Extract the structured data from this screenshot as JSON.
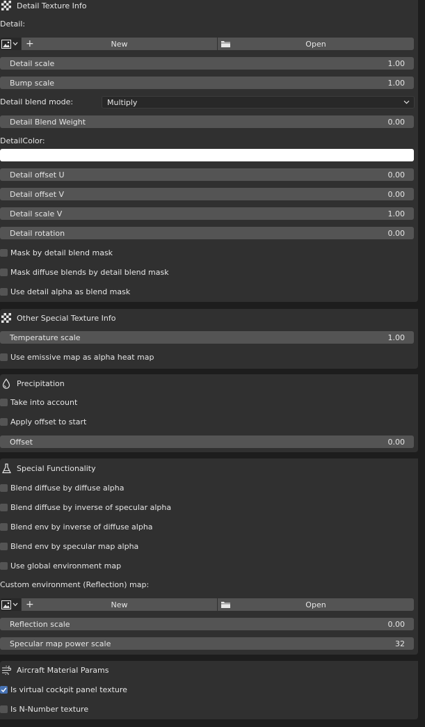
{
  "detail_panel": {
    "title": "Detail Texture Info",
    "detail_label": "Detail:",
    "new_label": "New",
    "open_label": "Open",
    "detail_scale": {
      "label": "Detail scale",
      "value": "1.00"
    },
    "bump_scale": {
      "label": "Bump scale",
      "value": "1.00"
    },
    "blend_mode": {
      "label": "Detail blend mode:",
      "value": "Multiply"
    },
    "blend_weight": {
      "label": "Detail Blend Weight",
      "value": "0.00"
    },
    "color_label": "DetailColor:",
    "color_value": "#ffffff",
    "offset_u": {
      "label": "Detail offset U",
      "value": "0.00"
    },
    "offset_v": {
      "label": "Detail offset V",
      "value": "0.00"
    },
    "scale_v": {
      "label": "Detail scale V",
      "value": "1.00"
    },
    "rotation": {
      "label": "Detail rotation",
      "value": "0.00"
    },
    "mask_blend": {
      "label": "Mask by detail blend mask",
      "checked": false
    },
    "mask_diffuse": {
      "label": "Mask diffuse blends by detail blend mask",
      "checked": false
    },
    "use_alpha": {
      "label": "Use detail alpha as blend mask",
      "checked": false
    }
  },
  "other_panel": {
    "title": "Other Special Texture Info",
    "temperature_scale": {
      "label": "Temperature scale",
      "value": "1.00"
    },
    "use_emissive": {
      "label": "Use emissive map as alpha heat map",
      "checked": false
    }
  },
  "precip_panel": {
    "title": "Precipitation",
    "take_into_account": {
      "label": "Take into account",
      "checked": false
    },
    "apply_offset": {
      "label": "Apply offset to start",
      "checked": false
    },
    "offset": {
      "label": "Offset",
      "value": "0.00"
    }
  },
  "special_panel": {
    "title": "Special Functionality",
    "blend_diffuse_alpha": {
      "label": "Blend diffuse by diffuse alpha",
      "checked": false
    },
    "blend_diffuse_inv_spec": {
      "label": "Blend diffuse by inverse of specular alpha",
      "checked": false
    },
    "blend_env_inv_diffuse": {
      "label": "Blend env by inverse of diffuse alpha",
      "checked": false
    },
    "blend_env_spec": {
      "label": "Blend env by specular map alpha",
      "checked": false
    },
    "use_global_env": {
      "label": "Use global environment map",
      "checked": false
    },
    "custom_env_label": "Custom environment (Reflection) map:",
    "new_label": "New",
    "open_label": "Open",
    "reflection_scale": {
      "label": "Reflection scale",
      "value": "0.00"
    },
    "specular_power": {
      "label": "Specular map power scale",
      "value": "32"
    }
  },
  "aircraft_panel": {
    "title": "Aircraft Material Params",
    "virtual_cockpit": {
      "label": "Is virtual cockpit panel texture",
      "checked": true
    },
    "n_number": {
      "label": "Is N-Number texture",
      "checked": false
    }
  },
  "colors": {
    "background": "#1d1d1d",
    "panel": "#303030",
    "field": "#545454",
    "accent": "#4772b3"
  },
  "icons": [
    "checker-icon",
    "image-icon",
    "plus-icon",
    "folder-icon",
    "chevron-down-icon",
    "drop-icon",
    "flask-icon",
    "wind-icon",
    "check-icon"
  ]
}
